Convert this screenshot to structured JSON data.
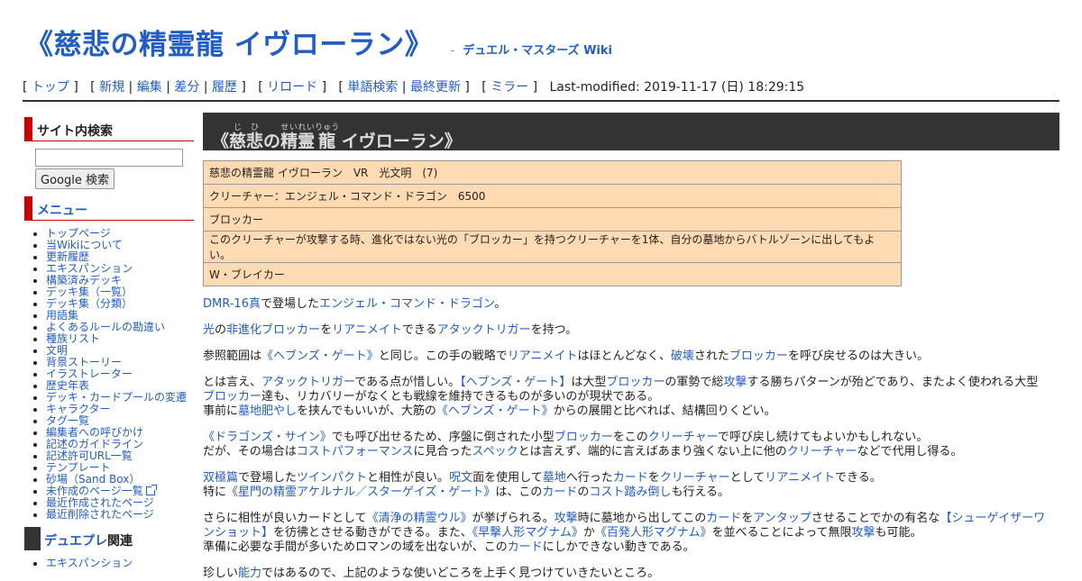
{
  "header": {
    "title": "《慈悲の精霊龍 イヴローラン》",
    "sep": "-",
    "site_name": "デュエル・マスターズ Wiki"
  },
  "nav": {
    "top": "トップ",
    "new": "新規",
    "edit": "編集",
    "diff": "差分",
    "history": "履歴",
    "reload": "リロード",
    "search": "単語検索",
    "recent": "最終更新",
    "mirror": "ミラー",
    "last_modified": "Last-modified: 2019-11-17 (日) 18:29:15"
  },
  "sidebar": {
    "search_heading": "サイト内検索",
    "search_value": "",
    "search_button": "Google 検索",
    "menu_heading": "メニュー",
    "menu_items": [
      "トップページ",
      "当Wikiについて",
      "更新履歴",
      "エキスパンション",
      "構築済みデッキ",
      "デッキ集（一覧）",
      "デッキ集（分類）",
      "用語集",
      "よくあるルールの勘違い",
      "種族リスト",
      "文明",
      "背景ストーリー",
      "イラストレーター",
      "歴史年表",
      "デッキ・カードプールの変遷",
      "キャラクター",
      "タグ一覧",
      "編集者への呼びかけ",
      "記述のガイドライン",
      "記述許可URL一覧",
      "テンプレート",
      "砂場（Sand Box）",
      "未作成のページ一覧",
      "最近作成されたページ",
      "最近削除されたページ"
    ],
    "duepre_heading_link": "デュエプレ",
    "duepre_heading_rest": "関連",
    "duepre_items": [
      "エキスパンション"
    ]
  },
  "card": {
    "title_open": "《",
    "kanji1": "慈",
    "ruby1": "じ",
    "kanji2": "悲",
    "ruby2": "ひ",
    "kanji3": "の",
    "kanji4": "精",
    "ruby4": "せい",
    "kanji5": "霊",
    "ruby5": "れい",
    "kanji6": "龍",
    "ruby6": "りゅう",
    "title_rest": " イヴローラン》",
    "rows": [
      "慈悲の精霊龍 イヴローラン　VR　光文明　(7)",
      "クリーチャー：エンジェル・コマンド・ドラゴン　6500",
      "ブロッカー",
      "このクリーチャーが攻撃する時、進化ではない光の「ブロッカー」を持つクリーチャーを1体、自分の墓地からバトルゾーンに出してもよい。",
      "W・ブレイカー"
    ]
  },
  "body": {
    "p1": {
      "a1": "DMR-16真",
      "t1": "で登場した",
      "a2": "エンジェル・コマンド・ドラゴン",
      "t2": "。"
    },
    "p2": {
      "a1": "光",
      "t1": "の",
      "a2": "非進化",
      "a3": "ブロッカー",
      "t2": "を",
      "a4": "リアニメイト",
      "t3": "できる",
      "a5": "アタックトリガー",
      "t4": "を持つ。"
    },
    "p3": {
      "t1": "参照範囲は",
      "a1": "《ヘブンズ・ゲート》",
      "t2": "と同じ。この手の戦略で",
      "a2": "リアニメイト",
      "t3": "はほとんどなく、",
      "a3": "破壊",
      "t4": "された",
      "a4": "ブロッカー",
      "t5": "を呼び戻せるのは大きい。"
    },
    "p4": {
      "t1": "とは言え、",
      "a1": "アタックトリガー",
      "t2": "である点が惜しい。",
      "a2": "【ヘブンズ・ゲート】",
      "t3": "は大型",
      "a3": "ブロッカー",
      "t4": "の軍勢で総",
      "a4": "攻撃",
      "t5": "する勝ちパターンが殆どであり、またよく使われる大型",
      "a5": "ブロッカー",
      "t6": "達も、リカバリーがなくとも戦線を維持できるものが多いのが現状である。",
      "t7": "事前に",
      "a6": "墓地肥やし",
      "t8": "を挟んでもいいが、大筋の",
      "a7": "《ヘブンズ・ゲート》",
      "t9": "からの展開と比べれば、結構回りくどい。"
    },
    "p5": {
      "a1": "《ドラゴンズ・サイン》",
      "t1": "でも呼び出せるため、序盤に倒された小型",
      "a2": "ブロッカー",
      "t2": "をこの",
      "a3": "クリーチャー",
      "t3": "で呼び戻し続けてもよいかもしれない。",
      "t4": "だが、その場合は",
      "a4": "コストパフォーマンス",
      "t5": "に見合った",
      "a5": "スペック",
      "t6": "とは言えず、端的に言えばあまり強くない上に他の",
      "a6": "クリーチャー",
      "t7": "などで代用し得る。"
    },
    "p6": {
      "a1": "双極篇",
      "t1": "で登場した",
      "a2": "ツインパクト",
      "t2": "と相性が良い。",
      "a3": "呪文",
      "t3": "面を使用して",
      "a4": "墓地",
      "t4": "へ行った",
      "a5": "カード",
      "t5": "を",
      "a6": "クリーチャー",
      "t6": "として",
      "a7": "リアニメイト",
      "t7": "できる。",
      "t8": "特に",
      "a8": "《星門の精霊アケルナル／スターゲイズ・ゲート》",
      "t9": "は、この",
      "a9": "カード",
      "t10": "の",
      "a10": "コスト踏み倒し",
      "t11": "も行える。"
    },
    "p7": {
      "t1": "さらに相性が良いカードとして",
      "a1": "《清浄の精霊ウル》",
      "t2": "が挙げられる。",
      "a2": "攻撃",
      "t3": "時に墓地から出してこの",
      "a3": "カード",
      "t4": "を",
      "a4": "アンタップ",
      "t5": "させることでかの有名な",
      "a5": "【シューゲイザーワ",
      "a5b": "ンショット】",
      "t6": "を彷彿とさせる動きができる。また、",
      "a6": "《早撃人形マグナム》",
      "t7": "か",
      "a7": "《百発人形マグナム》",
      "t8": "を並べることによって無限",
      "a8": "攻撃",
      "t9": "も可能。",
      "t10": "準備に必要な手間が多いためロマンの域を出ないが、この",
      "a9": "カード",
      "t11": "にしかできない動きである。"
    },
    "p8": {
      "t1": "珍しい",
      "a1": "能力",
      "t2": "ではあるので、上記のような使いどころを上手く見つけていきたいところ。"
    }
  },
  "colors": {
    "link": "#215dc6",
    "accent_red": "#cc0000",
    "card_bg": "#ffdab3",
    "title_bar": "#333333"
  }
}
